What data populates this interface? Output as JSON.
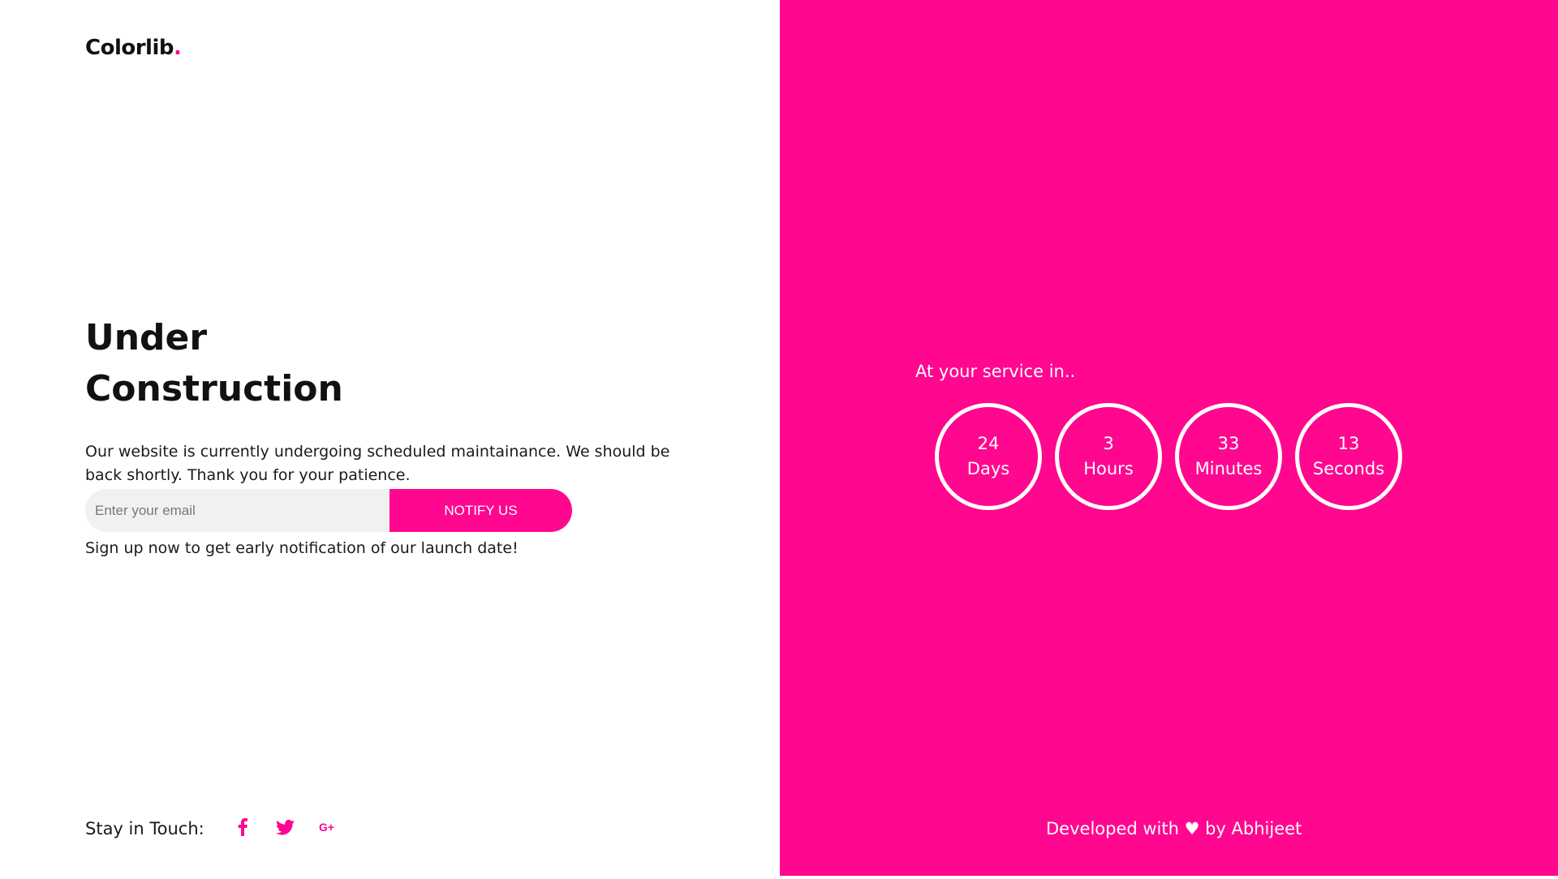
{
  "brand": {
    "name": "Colorlib",
    "dot": "."
  },
  "hero": {
    "title_line1": "Under",
    "title_line2": "Construction",
    "description": "Our website is currently undergoing scheduled maintainance. We should be back shortly. Thank you for your patience."
  },
  "signup_form": {
    "email_placeholder": "Enter your email",
    "email_value": "",
    "button_label": "NOTIFY US",
    "note": "Sign up now to get early notification of our launch date!"
  },
  "social": {
    "label": "Stay in Touch:",
    "items": [
      {
        "name": "facebook-icon"
      },
      {
        "name": "twitter-icon"
      },
      {
        "name": "google-plus-icon"
      }
    ]
  },
  "countdown": {
    "heading": "At your service in..",
    "units": [
      {
        "value": "24",
        "label": "Days"
      },
      {
        "value": "3",
        "label": "Hours"
      },
      {
        "value": "33",
        "label": "Minutes"
      },
      {
        "value": "13",
        "label": "Seconds"
      }
    ]
  },
  "footer": {
    "credit": "Developed with ♥ by Abhijeet"
  },
  "colors": {
    "accent": "#ff078f",
    "text": "#111111",
    "input_bg": "#f1f1f1"
  }
}
